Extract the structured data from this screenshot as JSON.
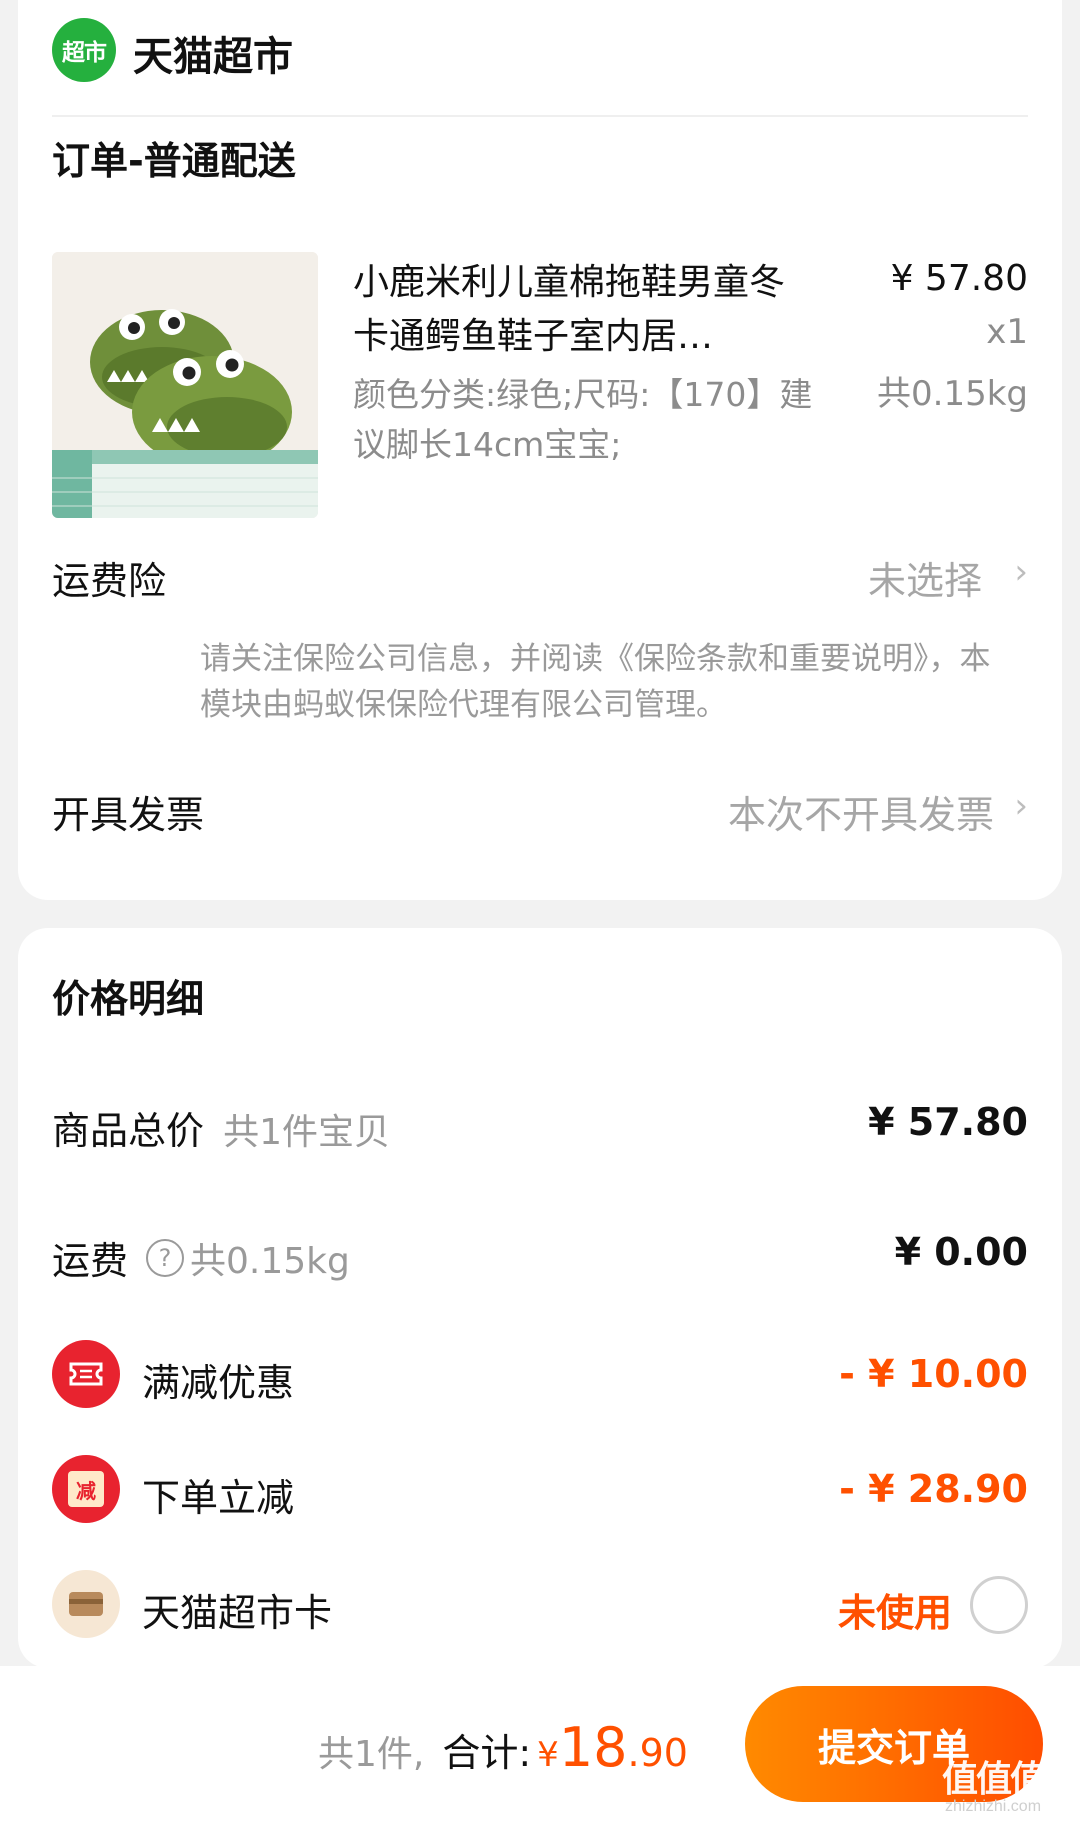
{
  "store": {
    "logo_text": "超市",
    "name": "天猫超市",
    "brand_color": "#25b03e"
  },
  "order": {
    "section_title": "订单-普通配送",
    "product": {
      "title": "小鹿米利儿童棉拖鞋男童冬卡通鳄鱼鞋子室内居…",
      "sku": "颜色分类:绿色;尺码:【170】建议脚长14cm宝宝;",
      "price": "¥ 57.80",
      "quantity": "x1",
      "weight": "共0.15kg",
      "image_icon": "green-crocodile-slipper"
    },
    "shipping_insurance": {
      "label": "运费险",
      "value": "未选择",
      "note": "请关注保险公司信息，并阅读《保险条款和重要说明》，本模块由蚂蚁保保险代理有限公司管理。"
    },
    "invoice": {
      "label": "开具发票",
      "value": "本次不开具发票"
    }
  },
  "price_detail": {
    "title": "价格明细",
    "goods_total": {
      "label": "商品总价",
      "sub": "共1件宝贝",
      "value": "¥ 57.80"
    },
    "shipping": {
      "label": "运费",
      "sub": "共0.15kg",
      "value": "¥ 0.00"
    },
    "full_reduction": {
      "label": "满减优惠",
      "value": "- ¥ 10.00",
      "icon": "coupon-icon"
    },
    "order_discount": {
      "label": "下单立减",
      "value": "- ¥ 28.90",
      "icon_text": "减"
    },
    "supermarket_card": {
      "label": "天猫超市卡",
      "value": "未使用",
      "icon": "card-icon"
    }
  },
  "bottom_bar": {
    "count": "共1件,",
    "total_label": "合计:",
    "currency": "¥",
    "total_int": "18",
    "total_dec": ".90",
    "submit_label": "提交订单",
    "watermark_mark": "值值值",
    "watermark_text": "zhizhizhi.com"
  },
  "colors": {
    "accent": "#ff5000",
    "discount_red": "#e8232f",
    "card_gold": "#c8a57a"
  }
}
